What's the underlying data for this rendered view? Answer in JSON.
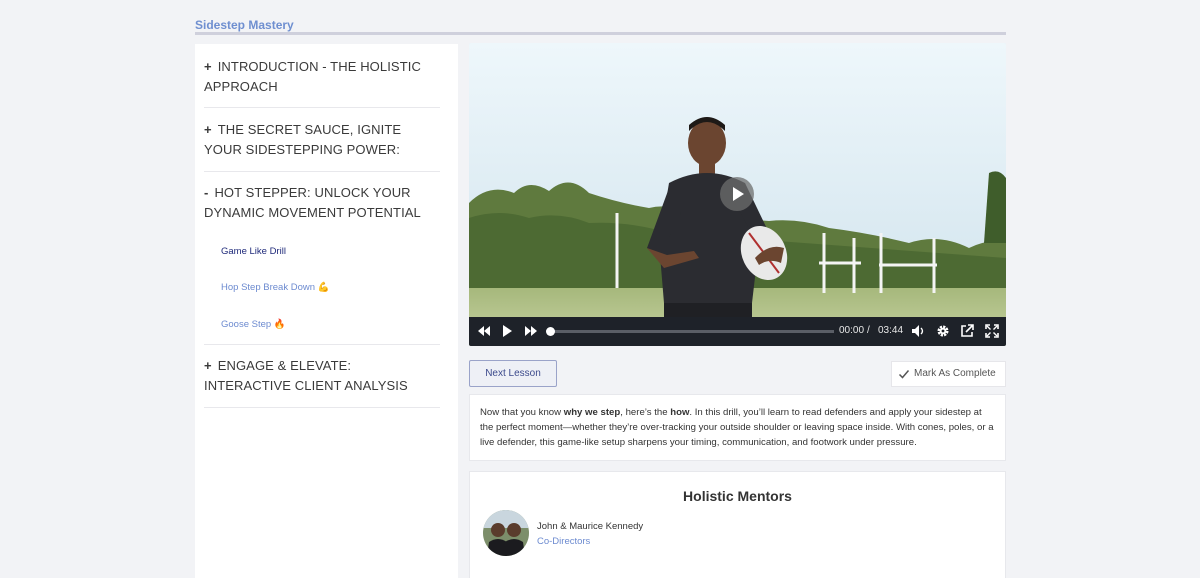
{
  "course": {
    "title": "Sidestep Mastery"
  },
  "sidebar": {
    "sections": [
      {
        "sign": "+",
        "title": "INTRODUCTION - THE HOLISTIC APPROACH"
      },
      {
        "sign": "+",
        "title": "THE SECRET SAUCE, IGNITE YOUR SIDESTEPPING POWER:"
      },
      {
        "sign": "-",
        "title": "HOT STEPPER: UNLOCK YOUR DYNAMIC MOVEMENT POTENTIAL"
      },
      {
        "sign": "+",
        "title": "ENGAGE & ELEVATE: INTERACTIVE CLIENT ANALYSIS"
      }
    ],
    "lessons": [
      {
        "label": "Game Like Drill",
        "emoji": ""
      },
      {
        "label": "Hop Step Break Down",
        "emoji": "💪"
      },
      {
        "label": "Goose Step",
        "emoji": "🔥"
      }
    ]
  },
  "player": {
    "current_time": "00:00",
    "separator": "/",
    "duration": "03:44",
    "progress_fraction": 0.0
  },
  "actions": {
    "next_label": "Next Lesson",
    "complete_label": "Mark As Complete"
  },
  "description": {
    "t1": "Now that you know ",
    "b1": "why we step",
    "t2": ", here’s the ",
    "b2": "how",
    "t3": ". In this drill, you’ll learn to read defenders and apply your sidestep at the perfect moment—whether they’re over-tracking your outside shoulder or leaving space inside. With cones, poles, or a live defender, this game-like setup sharpens your timing, communication, and footwork under pressure."
  },
  "mentors": {
    "title": "Holistic Mentors",
    "name": "John & Maurice Kennedy",
    "role": "Co-Directors"
  },
  "colors": {
    "accent": "#6f8fd0",
    "active_lesson": "#1f2a7a",
    "controls_bg": "#1e2229"
  }
}
